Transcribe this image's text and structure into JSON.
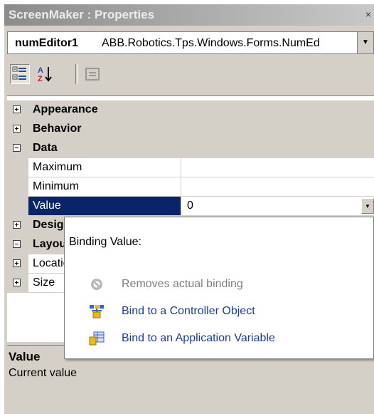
{
  "window": {
    "title": "ScreenMaker : Properties",
    "close_glyph": "×"
  },
  "object_selector": {
    "name": "numEditor1",
    "type": "ABB.Robotics.Tps.Windows.Forms.NumEd",
    "dropdown_icon": "chevron-down-icon"
  },
  "toolbar": {
    "buttons": [
      {
        "icon": "categorized-icon",
        "pressed": true
      },
      {
        "icon": "alphabetical-sort-icon",
        "pressed": false
      },
      {
        "icon": "property-pages-icon",
        "pressed": false
      }
    ]
  },
  "grid": {
    "categories": {
      "appearance": "Appearance",
      "behavior": "Behavior",
      "data": "Data",
      "design": "Design",
      "layout": "Layout"
    },
    "data_props": [
      {
        "name": "Maximum",
        "value": ""
      },
      {
        "name": "Minimum",
        "value": ""
      },
      {
        "name": "Value",
        "value": "0",
        "selected": true
      }
    ],
    "layout_props": [
      {
        "name": "Location"
      },
      {
        "name": "Size"
      }
    ]
  },
  "description": {
    "title": "Value",
    "text": "Current value"
  },
  "binding_popup": {
    "heading": "Binding Value:",
    "items": [
      {
        "label": "Removes actual binding",
        "icon": "remove-binding-icon",
        "enabled": false
      },
      {
        "label": "Bind to a Controller Object",
        "icon": "controller-object-icon",
        "enabled": true
      },
      {
        "label": "Bind to an Application Variable",
        "icon": "application-variable-icon",
        "enabled": true
      }
    ]
  },
  "colors": {
    "selection": "#0a246a",
    "link": "#1a3c9c",
    "panel": "#d4d0c8"
  }
}
